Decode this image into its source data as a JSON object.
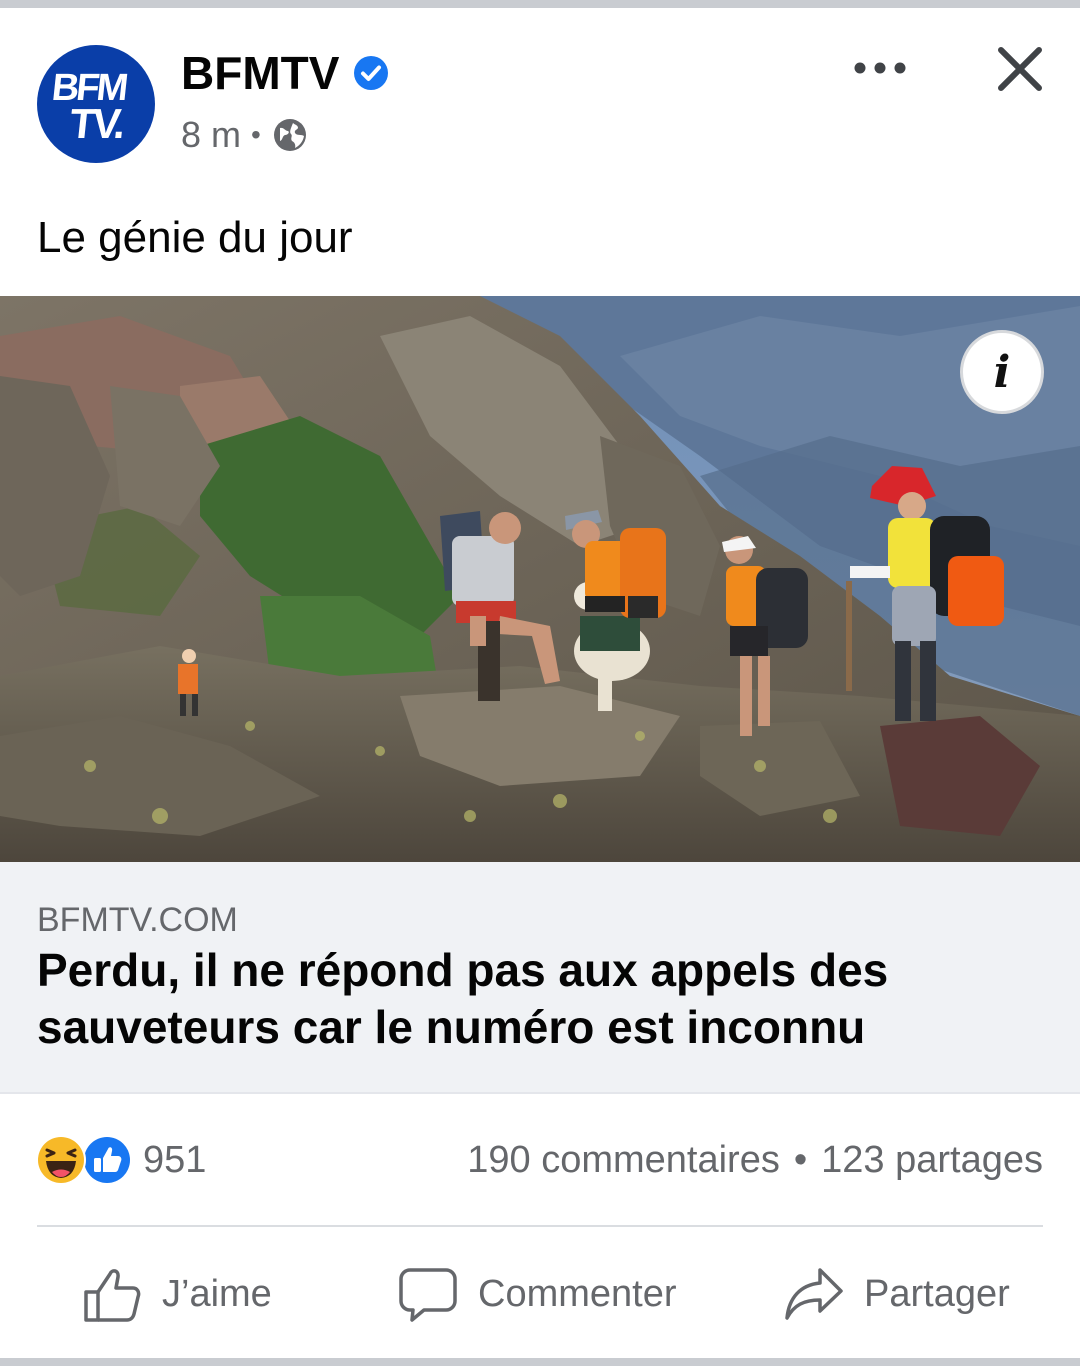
{
  "post": {
    "page_name": "BFMTV",
    "avatar": {
      "line1": "BFM",
      "line2": "TV."
    },
    "time": "8 m",
    "audience": "globe-icon",
    "caption": "Le génie du jour"
  },
  "link_preview": {
    "domain": "BFMTV.COM",
    "title": "Perdu, il ne répond pas aux appels des sauveteurs car le numéro est inconnu",
    "info_label": "i"
  },
  "engagement": {
    "reactions": [
      "haha-icon",
      "like-icon"
    ],
    "reaction_count": "951",
    "comments": "190 commentaires",
    "separator": "•",
    "shares": "123 partages"
  },
  "actions": {
    "like": "J’aime",
    "comment": "Commenter",
    "share": "Partager"
  },
  "colors": {
    "brand_blue": "#1877f2",
    "avatar_blue": "#0a3ea8",
    "secondary_text": "#65676b",
    "link_background": "#f0f2f5"
  }
}
